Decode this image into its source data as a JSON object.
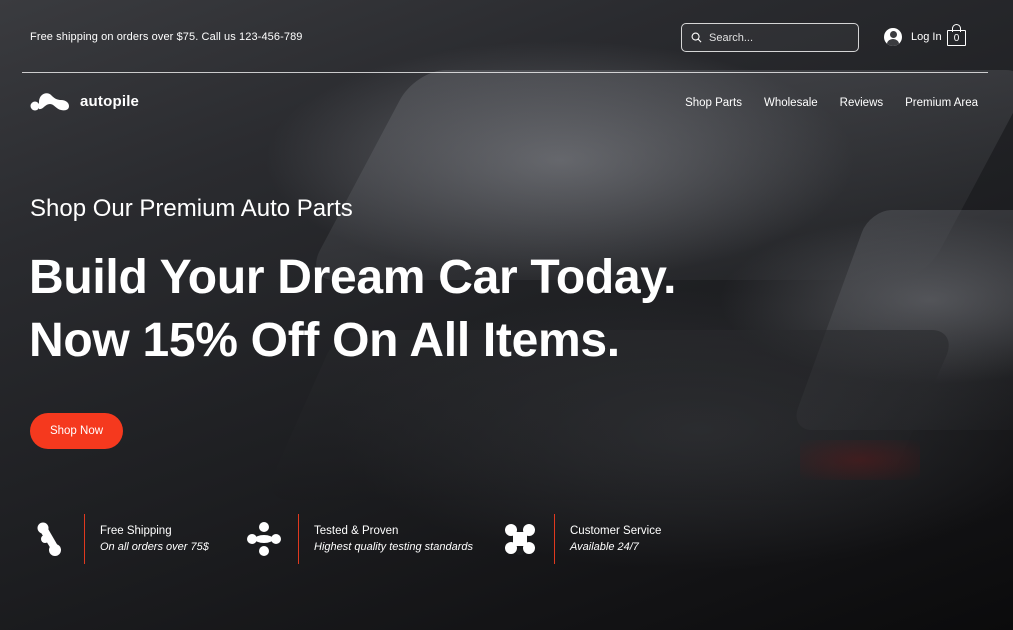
{
  "topbar": {
    "promo": "Free shipping on orders over $75. Call us 123-456-789",
    "search_placeholder": "Search...",
    "login_label": "Log In",
    "cart_count": "0"
  },
  "brand": {
    "name": "autopile"
  },
  "nav": {
    "items": [
      "Shop Parts",
      "Wholesale",
      "Reviews",
      "Premium Area"
    ]
  },
  "hero": {
    "eyebrow": "Shop Our Premium Auto Parts",
    "headline_line1": "Build Your Dream Car Today.",
    "headline_line2": "Now 15% Off On All Items.",
    "cta_label": "Shop Now"
  },
  "features": [
    {
      "title": "Free Shipping",
      "subtitle": "On all orders over 75$",
      "icon": "shipping-icon"
    },
    {
      "title": "Tested & Proven",
      "subtitle": "Highest quality testing standards",
      "icon": "tested-icon"
    },
    {
      "title": "Customer Service",
      "subtitle": "Available 24/7",
      "icon": "service-icon"
    }
  ],
  "colors": {
    "accent": "#f5391e",
    "divider": "#e0391f",
    "text": "#ffffff"
  }
}
